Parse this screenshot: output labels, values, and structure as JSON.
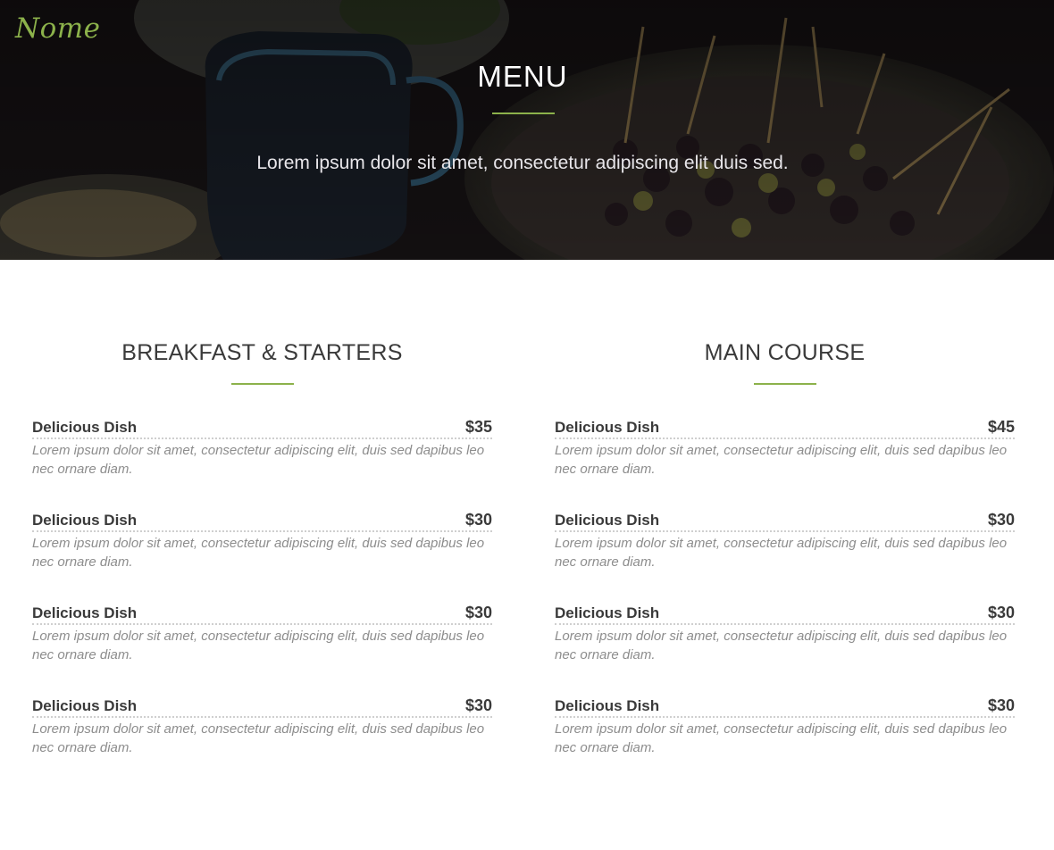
{
  "brand": {
    "logo_text": "Nome",
    "accent_color": "#8cb24b"
  },
  "hero": {
    "title": "MENU",
    "subtitle": "Lorem ipsum dolor sit amet, consectetur adipiscing elit duis sed."
  },
  "menu": {
    "left": {
      "title": "BREAKFAST & STARTERS",
      "items": [
        {
          "name": "Delicious Dish",
          "price": "$35",
          "description": "Lorem ipsum dolor sit amet, consectetur adipiscing elit, duis sed dapibus leo nec ornare diam."
        },
        {
          "name": "Delicious Dish",
          "price": "$30",
          "description": "Lorem ipsum dolor sit amet, consectetur adipiscing elit, duis sed dapibus leo nec ornare diam."
        },
        {
          "name": "Delicious Dish",
          "price": "$30",
          "description": "Lorem ipsum dolor sit amet, consectetur adipiscing elit, duis sed dapibus leo nec ornare diam."
        },
        {
          "name": "Delicious Dish",
          "price": "$30",
          "description": "Lorem ipsum dolor sit amet, consectetur adipiscing elit, duis sed dapibus leo nec ornare diam."
        }
      ]
    },
    "right": {
      "title": "MAIN COURSE",
      "items": [
        {
          "name": "Delicious Dish",
          "price": "$45",
          "description": "Lorem ipsum dolor sit amet, consectetur adipiscing elit, duis sed dapibus leo nec ornare diam."
        },
        {
          "name": "Delicious Dish",
          "price": "$30",
          "description": "Lorem ipsum dolor sit amet, consectetur adipiscing elit, duis sed dapibus leo nec ornare diam."
        },
        {
          "name": "Delicious Dish",
          "price": "$30",
          "description": "Lorem ipsum dolor sit amet, consectetur adipiscing elit, duis sed dapibus leo nec ornare diam."
        },
        {
          "name": "Delicious Dish",
          "price": "$30",
          "description": "Lorem ipsum dolor sit amet, consectetur adipiscing elit, duis sed dapibus leo nec ornare diam."
        }
      ]
    }
  }
}
